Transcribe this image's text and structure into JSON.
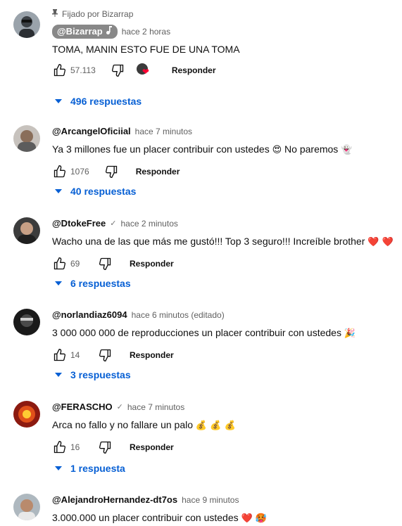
{
  "comments": [
    {
      "pinned_label": "Fijado por Bizarrap",
      "author": "@Bizarrap",
      "time": "hace 2 horas",
      "text": "TOMA, MANIN ESTO FUE DE UNA TOMA",
      "likes": "57.113",
      "reply_label": "Responder",
      "replies_label": "496 respuestas"
    },
    {
      "author": "@ArcangelOficiial",
      "time": "hace 7 minutos",
      "text": "Ya 3 millones fue un placer contribuir con ustedes",
      "text_emoji": "😍",
      "text_tail": "No paremos",
      "text_tail_emoji": "👻",
      "likes": "1076",
      "reply_label": "Responder",
      "replies_label": "40 respuestas"
    },
    {
      "author": "@DtokeFree",
      "time": "hace 2 minutos",
      "text": "Wacho una de las que más me gustó!!! Top 3 seguro!!! Increíble brother",
      "text_emoji": "❤️ ❤️",
      "likes": "69",
      "reply_label": "Responder",
      "replies_label": "6 respuestas"
    },
    {
      "author": "@norlandiaz6094",
      "time": "hace 6 minutos (editado)",
      "text": "3 000 000 000 de reproducciones un placer contribuir con ustedes",
      "text_emoji": "🎉",
      "likes": "14",
      "reply_label": "Responder",
      "replies_label": "3 respuestas"
    },
    {
      "author": "@FERASCHO",
      "time": "hace 7 minutos",
      "text": "Arca no fallo y no fallare un palo",
      "text_emoji": "💰 💰 💰",
      "likes": "16",
      "reply_label": "Responder",
      "replies_label": "1 respuesta"
    },
    {
      "author": "@AlejandroHernandez-dt7os",
      "time": "hace 9 minutos",
      "text": "3.000.000 un placer contribuir con ustedes",
      "text_emoji": "❤️ 🥵"
    }
  ],
  "colors": {
    "link_blue": "#065fd4",
    "meta_gray": "#606060",
    "badge_gray": "#888888"
  },
  "icons": [
    "pin-icon",
    "music-note-icon",
    "thumbs-up-icon",
    "thumbs-down-icon",
    "verified-check-icon",
    "creator-heart-icon",
    "caret-down-icon"
  ]
}
